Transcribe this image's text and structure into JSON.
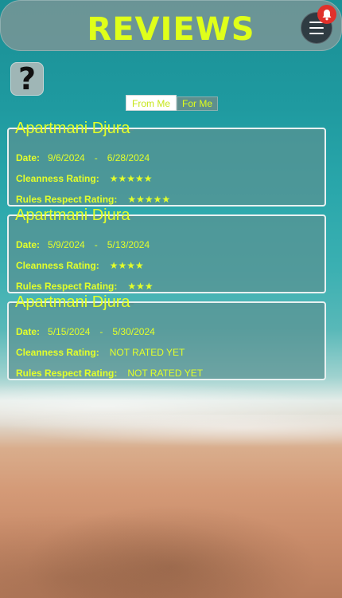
{
  "header": {
    "title": "REVIEWS"
  },
  "tabs": [
    {
      "label": "From Me",
      "active": true
    },
    {
      "label": "For Me",
      "active": false
    }
  ],
  "labels": {
    "date": "Date:",
    "cleanness": "Cleanness Rating:",
    "rules": "Rules Respect Rating:",
    "date_separator": "-"
  },
  "reviews": [
    {
      "apartment": "Apartmani Djura",
      "start": "9/6/2024",
      "end": "6/28/2024",
      "cleanness": "★★★★★",
      "cleanness_stars": 5,
      "rules": "★★★★★",
      "rules_stars": 5
    },
    {
      "apartment": "Apartmani Djura",
      "start": "5/9/2024",
      "end": "5/13/2024",
      "cleanness": "★★★★",
      "cleanness_stars": 4,
      "rules": "★★★",
      "rules_stars": 3
    },
    {
      "apartment": "Apartmani Djura",
      "start": "5/15/2024",
      "end": "5/30/2024",
      "cleanness": "NOT RATED YET",
      "rules": "NOT RATED YET"
    }
  ],
  "colors": {
    "accent": "#dfff1a",
    "notification": "#e0312b"
  },
  "icons": {
    "menu": "hamburger-menu-icon",
    "notification": "bell-icon",
    "help": "question-mark-icon"
  }
}
